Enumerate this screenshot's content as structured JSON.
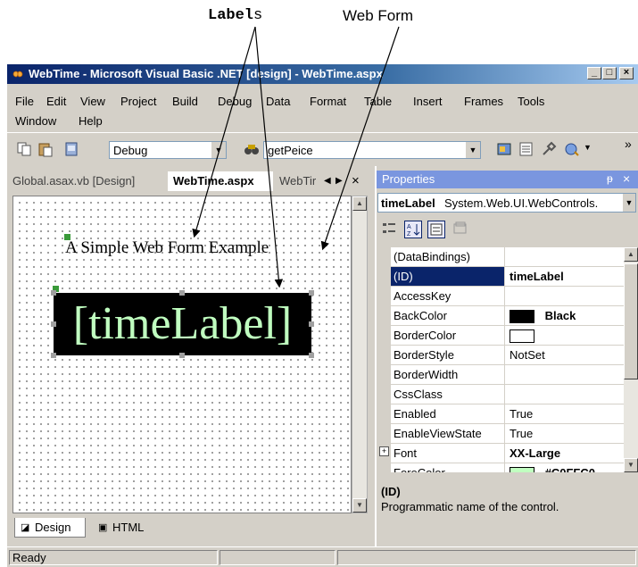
{
  "callouts": {
    "labels_bold": "Label",
    "labels_suffix": "s",
    "web_form": "Web Form"
  },
  "window": {
    "title": "WebTime - Microsoft Visual Basic .NET [design] - WebTime.aspx",
    "minimize": "_",
    "maximize": "□",
    "close": "×"
  },
  "menu": {
    "row1": [
      "File",
      "Edit",
      "View",
      "Project",
      "Build",
      "Debug",
      "Data",
      "Format",
      "Table",
      "Insert",
      "Frames",
      "Tools"
    ],
    "row2": [
      "Window",
      "Help"
    ]
  },
  "toolbar": {
    "config_value": "Debug",
    "find_value": "getPeice",
    "overflow": "»"
  },
  "tabs": {
    "items": [
      "Global.asax.vb [Design]",
      "WebTime.aspx",
      "WebTir"
    ],
    "close": "×"
  },
  "design": {
    "page_heading": "A Simple Web Form Example",
    "time_label": "[timeLabel]",
    "bottom_tabs": [
      "Design",
      "HTML"
    ]
  },
  "status": {
    "text": "Ready"
  },
  "properties": {
    "title": "Properties",
    "pin": "ᵽ",
    "close": "×",
    "object_name": "timeLabel",
    "object_type": "System.Web.UI.WebControls.",
    "rows": [
      {
        "name": "(DataBindings)",
        "value": ""
      },
      {
        "name": "(ID)",
        "value": "timeLabel"
      },
      {
        "name": "AccessKey",
        "value": ""
      },
      {
        "name": "BackColor",
        "value": "Black"
      },
      {
        "name": "BorderColor",
        "value": ""
      },
      {
        "name": "BorderStyle",
        "value": "NotSet"
      },
      {
        "name": "BorderWidth",
        "value": ""
      },
      {
        "name": "CssClass",
        "value": ""
      },
      {
        "name": "Enabled",
        "value": "True"
      },
      {
        "name": "EnableViewState",
        "value": "True"
      },
      {
        "name": "Font",
        "value": "XX-Large"
      },
      {
        "name": "ForeColor",
        "value": "#C0FFC0"
      }
    ],
    "desc_title": "(ID)",
    "desc_text": "Programmatic name of the control."
  },
  "colors": {
    "backcolor_swatch": "#000000",
    "bordercolor_swatch": "#ffffff",
    "forecolor_swatch": "#c0ffc0",
    "label_text": "#c0ffc0"
  }
}
